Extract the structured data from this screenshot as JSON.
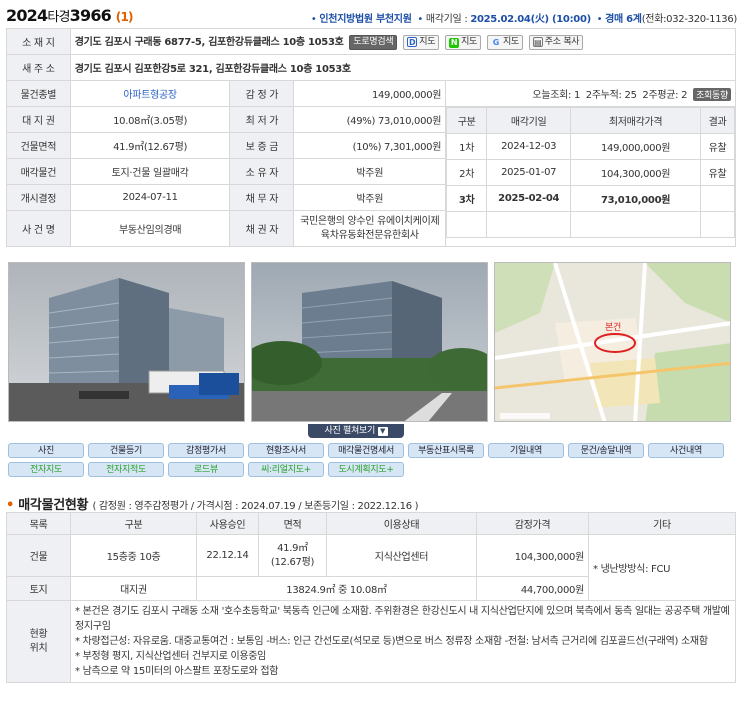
{
  "header": {
    "case_year": "2024",
    "case_type": "타경",
    "case_num": "3966",
    "case_count": "(1)",
    "court": "인천지방법원 부천지원",
    "sale_label": "매각기일 :",
    "sale_date": "2025.02.04(火) (10:00)",
    "dept": "경매 6계",
    "phone": "(전화:032-320-1136)"
  },
  "property": {
    "addr_label": "소 재 지",
    "addr": "경기도 김포시 구래동 6877-5, 김포한강듀클래스 10층 1053호",
    "btn_road": "도로명검색",
    "btn_daum": "지도",
    "btn_naver": "지도",
    "btn_google": "지도",
    "btn_copy": "주소 복사",
    "new_addr_label": "새 주 소",
    "new_addr": "경기도 김포시 김포한강5로 321, 김포한강듀클래스 10층 1053호",
    "type_label": "물건종별",
    "type": "아파트형공장",
    "appraisal_label": "감 정 가",
    "appraisal": "149,000,000원",
    "land_label": "대 지 권",
    "land": "10.08㎡(3.05평)",
    "min_label": "최 저 가",
    "min": "(49%) 73,010,000원",
    "bldg_label": "건물면적",
    "bldg": "41.9㎡(12.67평)",
    "deposit_label": "보 증 금",
    "deposit": "(10%) 7,301,000원",
    "sale_obj_label": "매각물건",
    "sale_obj": "토지·건물 일괄매각",
    "owner_label": "소 유 자",
    "owner": "박주원",
    "start_label": "개시결정",
    "start": "2024-07-11",
    "debtor_label": "채 무 자",
    "debtor": "박주원",
    "case_name_label": "사 건 명",
    "case_name": "부동산임의경매",
    "creditor_label": "채 권 자",
    "creditor": "국민은행의 양수인 유에이치케이제육차유동화전문유한회사"
  },
  "stats": {
    "today": "오늘조회: 1",
    "week2": "2주누적: 25",
    "avg2": "2주평균: 2",
    "btn": "조회동향"
  },
  "history": {
    "headers": [
      "구분",
      "매각기일",
      "최저매각가격",
      "결과"
    ],
    "rows": [
      [
        "1차",
        "2024-12-03",
        "149,000,000원",
        "유찰"
      ],
      [
        "2차",
        "2025-01-07",
        "104,300,000원",
        "유찰"
      ],
      [
        "3차",
        "2025-02-04",
        "73,010,000원",
        ""
      ]
    ]
  },
  "photo_bar": "사진 펼쳐보기",
  "map_label": "본건",
  "tabs": {
    "row1": [
      "사진",
      "건물등기",
      "감정평가서",
      "현황조사서",
      "매각물건명세서",
      "부동산표시목록",
      "기일내역",
      "문건/송달내역",
      "사건내역"
    ],
    "row2": [
      "전자지도",
      "전자지적도",
      "로드뷰",
      "씨:리얼지도+",
      "도시계획지도+"
    ]
  },
  "section": {
    "title": "매각물건현황",
    "sub": "( 감정원 : 영주감정평가 / 가격시점 : 2024.07.19 / 보존등기일 : 2022.12.16 )"
  },
  "items": {
    "headers": [
      "목록",
      "구분",
      "사용승인",
      "면적",
      "이용상태",
      "감정가격",
      "기타"
    ],
    "bldg_label": "건물",
    "bldg_type": "15층중 10층",
    "bldg_approve": "22.12.14",
    "bldg_area1": "41.9㎡",
    "bldg_area2": "(12.67평)",
    "bldg_use": "지식산업센터",
    "bldg_price": "104,300,000원",
    "etc": "* 냉난방방식: FCU",
    "land_label": "토지",
    "land_type": "대지권",
    "land_area": "13824.9㎡ 중 10.08㎡",
    "land_price": "44,700,000원",
    "loc_label1": "현황",
    "loc_label2": "위치",
    "notes": [
      "* 본건은 경기도 김포시 구래동 소재 '호수초등학교' 북동측 인근에 소재함. 주위환경은 한강신도시 내 지식산업단지에 있으며 북측에서 동측 일대는 공공주택 개발예정지구임",
      "* 차량접근성: 자유로움. 대중교통여건 : 보통임 -버스: 인근 간선도로(석모로 등)변으로 버스 정류장 소재함 -전철: 남서측 근거리에 김포골드선(구래역) 소재함",
      "* 부정형 평지, 지식산업센터 건부지로 이용중임",
      "* 남측으로 약 15미터의 아스팔트 포장도로와 접함"
    ]
  }
}
